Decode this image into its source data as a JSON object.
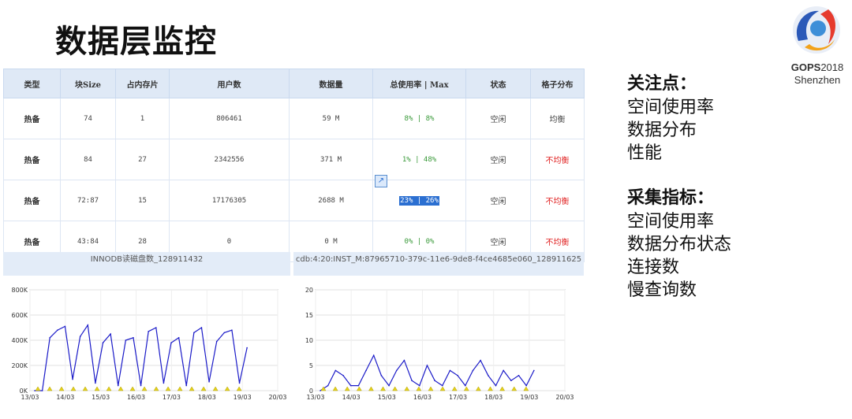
{
  "page": {
    "title": "数据层监控"
  },
  "logo": {
    "line1_bold": "GOPS",
    "line1_rest": "2018",
    "line2": "Shenzhen"
  },
  "table": {
    "headers": [
      "类型",
      "块Size",
      "占内存片",
      "用户数",
      "数据量",
      "总使用率 | Max",
      "状态",
      "格子分布"
    ],
    "rows": [
      [
        "热备",
        "74",
        "1",
        "806461",
        "59 M",
        "8% | 8%",
        "空闲",
        "均衡"
      ],
      [
        "热备",
        "84",
        "27",
        "2342556",
        "371 M",
        "1% | 48%",
        "空闲",
        "不均衡"
      ],
      [
        "热备",
        "72:87",
        "15",
        "17176305",
        "2688 M",
        "23% | 26%",
        "空闲",
        "不均衡"
      ],
      [
        "热备",
        "43:84",
        "28",
        "0",
        "0 M",
        "0% | 0%",
        "空闲",
        "不均衡"
      ]
    ]
  },
  "colors": {
    "header_bg": "#dfe9f6",
    "usage_green": "#3a9a3a",
    "unbalanced_red": "#e02020",
    "series_blue": "#1a1ac8",
    "marker_yellow": "#e6d21a"
  },
  "sidebar": {
    "focus_title": "关注点：",
    "focus_items": [
      "空间使用率",
      "数据分布",
      "性能"
    ],
    "collect_title": "采集指标：",
    "collect_items": [
      "空间使用率",
      "数据分布状态",
      "连接数",
      "慢查询数"
    ]
  },
  "chart_data": [
    {
      "type": "line",
      "title": "INNODB读磁盘数_128911432",
      "x_ticks": [
        "13/03",
        "14/03",
        "15/03",
        "16/03",
        "17/03",
        "18/03",
        "19/03",
        "20/03"
      ],
      "y_ticks": [
        "0K",
        "200K",
        "400K",
        "600K",
        "800K"
      ],
      "ylim": [
        0,
        800000
      ],
      "series": [
        {
          "values": [
            0,
            0,
            420000,
            480000,
            510000,
            90000,
            430000,
            520000,
            60000,
            380000,
            450000,
            40000,
            400000,
            420000,
            40000,
            470000,
            500000,
            60000,
            380000,
            420000,
            40000,
            460000,
            500000,
            70000,
            390000,
            460000,
            480000,
            60000,
            340000
          ]
        }
      ],
      "markers": "yellow triangles at baseline"
    },
    {
      "type": "line",
      "title": "cdb:4:20:INST_M:87965710-379c-11e6-9de8-f4ce4685e060_128911625",
      "x_ticks": [
        "13/03",
        "14/03",
        "15/03",
        "16/03",
        "17/03",
        "18/03",
        "19/03",
        "20/03"
      ],
      "y_ticks": [
        "0",
        "5",
        "10",
        "15",
        "20"
      ],
      "ylim": [
        0,
        20
      ],
      "series": [
        {
          "values": [
            0,
            1,
            4,
            3,
            1,
            1,
            4,
            7,
            3,
            1,
            4,
            6,
            2,
            1,
            5,
            2,
            1,
            4,
            3,
            1,
            4,
            6,
            3,
            1,
            4,
            2,
            3,
            1,
            4
          ]
        }
      ],
      "markers": "yellow triangles at baseline"
    }
  ]
}
